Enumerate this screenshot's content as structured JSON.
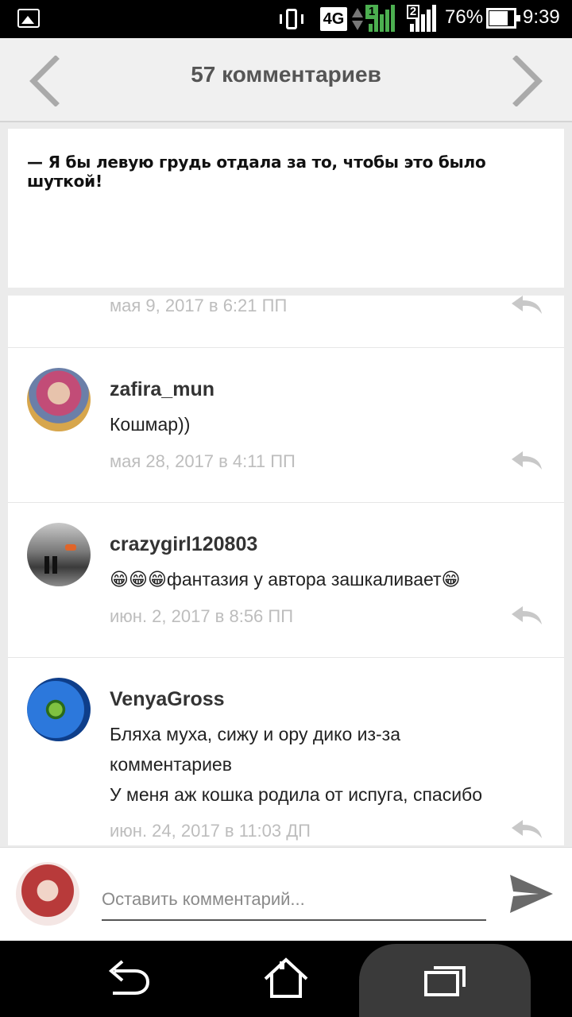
{
  "status_bar": {
    "network": "4G",
    "sim1": "1",
    "sim2": "2",
    "battery_percent": "76%",
    "battery_level": 0.76,
    "time": "9:39",
    "icons": [
      "gallery-icon",
      "vibrate-icon",
      "data-arrows-icon",
      "signal-icon",
      "battery-icon"
    ]
  },
  "header": {
    "title": "57 комментариев",
    "prev_icon": "chevron-left-icon",
    "next_icon": "chevron-right-icon"
  },
  "quote": {
    "text": "— Я бы левую грудь отдала за то, чтобы это было шуткой!"
  },
  "comments": [
    {
      "author": "",
      "text": "",
      "date": "мая 9, 2017 в 6:21 ПП",
      "partial": true
    },
    {
      "author": "zafira_mun",
      "text": "Кошмар))",
      "date": "мая 28, 2017 в 4:11 ПП",
      "avatar_colors": [
        "#d9a38c",
        "#b24a6a"
      ]
    },
    {
      "author": "crazygirl120803",
      "text": "😁😁😁фантазия у автора зашкаливает😁",
      "date": "июн. 2, 2017 в 8:56 ПП",
      "avatar_colors": [
        "#9a9a9a",
        "#3a3a3a"
      ]
    },
    {
      "author": "VenyaGross",
      "text": "Бляха муха, сижу и ору дико из-за\nкомментариев\nУ меня  аж кошка родила от испуга, спасибо",
      "date": "июн. 24, 2017 в 11:03 ДП",
      "avatar_colors": [
        "#1f6fd1",
        "#7fc241"
      ]
    }
  ],
  "input": {
    "placeholder": "Оставить комментарий...",
    "value": ""
  },
  "colors": {
    "header_bg": "#f0f0f0",
    "title": "#555555",
    "date": "#bdbdbd",
    "signal_green": "#4caf50"
  },
  "nav_bar": {
    "icons": [
      "back-icon",
      "home-icon",
      "recent-apps-icon"
    ]
  }
}
